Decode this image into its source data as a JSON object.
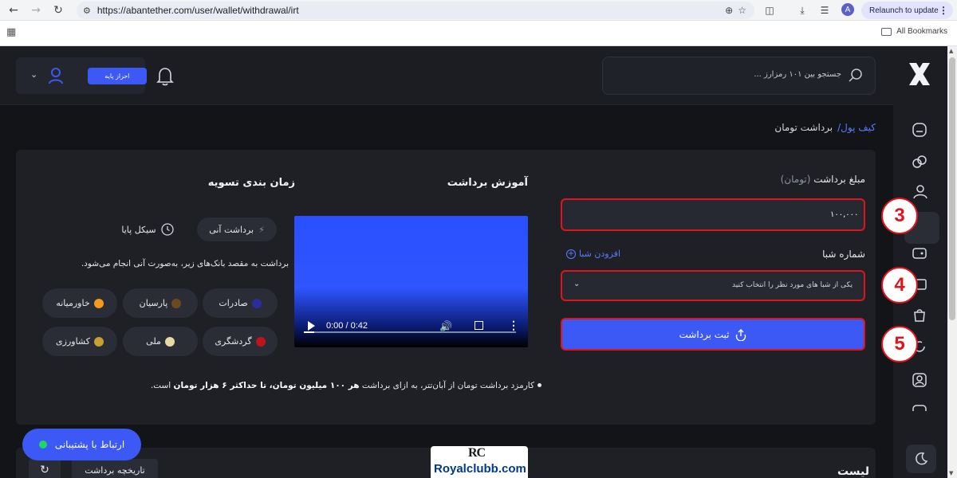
{
  "browser": {
    "url": "https://abantether.com/user/wallet/withdrawal/irt",
    "relaunch_label": "Relaunch to update",
    "profile_initial": "A",
    "bookmarks_label": "All Bookmarks"
  },
  "header": {
    "kyc_label": "احراز پایه",
    "search_placeholder": "جستجو بین ۱۰۱ رمزارز ..."
  },
  "breadcrumb": {
    "wallet": "کیف پول/",
    "current": "برداشت تومان"
  },
  "form": {
    "amount_label": "مبلغ برداشت",
    "amount_unit": "(تومان)",
    "amount_value": "۱۰۰,۰۰۰",
    "sheba_label": "شماره شبا",
    "add_sheba": "افزودن شبا",
    "sheba_placeholder": "یکی از شبا های مورد نظر را انتخاب کنید",
    "submit_label": "ثبت برداشت"
  },
  "steps": [
    "3",
    "4",
    "5"
  ],
  "tutorial": {
    "title": "آموزش برداشت",
    "time": "0:00 / 0:42",
    "progress": 0.05
  },
  "schedule": {
    "title": "زمان بندی تسویه",
    "tab_instant": "برداشت آنی",
    "tab_cycle": "سیکل پایا",
    "description": "برداشت به مقصد بانک‌های زیر، به‌صورت آنی انجام می‌شود.",
    "banks": [
      {
        "name": "صادرات",
        "color": "#2c2c9c"
      },
      {
        "name": "پارسیان",
        "color": "#6b4a1f"
      },
      {
        "name": "خاورمیانه",
        "color": "#f39a1c"
      },
      {
        "name": "گردشگری",
        "color": "#c0141b"
      },
      {
        "name": "ملی",
        "color": "#e9d8a6"
      },
      {
        "name": "کشاورزی",
        "color": "#c9a030"
      }
    ]
  },
  "fee_note": {
    "prefix": "کارمزد برداشت تومان از آبان‌تتر، به ازای برداشت ",
    "bold1": "هر ۱۰۰ میلیون تومان، تا حداکثر ۶ هزار تومان",
    "suffix": " است."
  },
  "history": {
    "title": "لیست برداشت‌ها",
    "history_button": "تاریخچه برداشت"
  },
  "support": {
    "label": "ارتباط با پشتیبانی"
  },
  "watermark": {
    "mark": "RC",
    "text": "Royalclubb.com"
  },
  "colors": {
    "accent": "#3c59f5",
    "highlight": "#e0141b",
    "background": "#121418",
    "card": "#1e2026"
  }
}
